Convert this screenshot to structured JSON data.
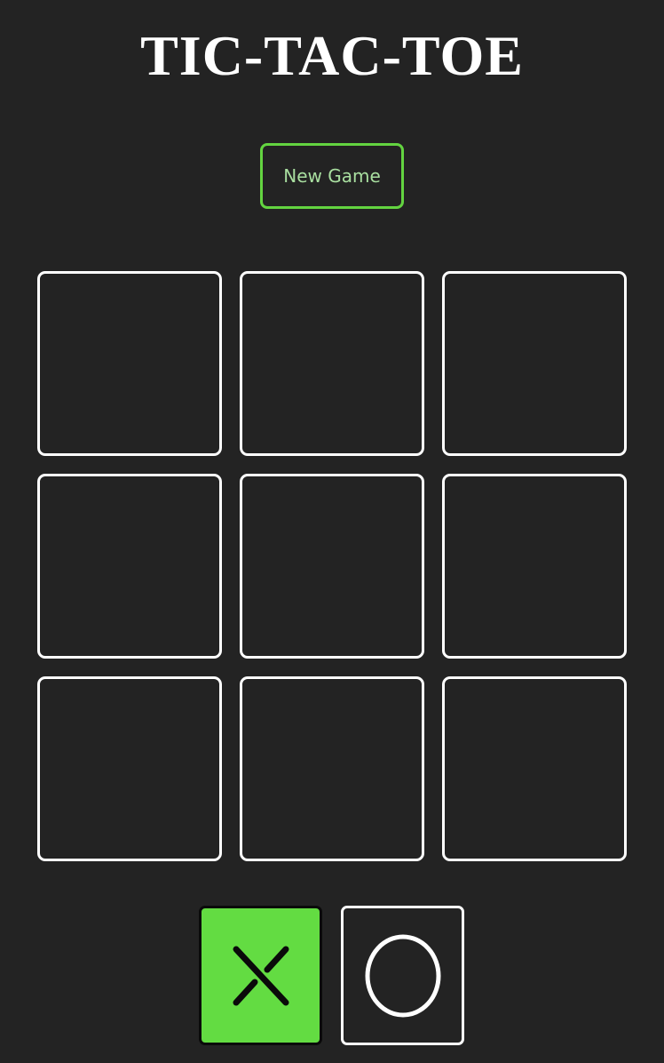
{
  "header": {
    "title": "TIC-TAC-TOE"
  },
  "controls": {
    "new_game_label": "New Game"
  },
  "board": {
    "cells": [
      "",
      "",
      "",
      "",
      "",
      "",
      "",
      "",
      ""
    ]
  },
  "player_select": {
    "options": [
      {
        "symbol": "X",
        "selected": true,
        "icon": "x-icon"
      },
      {
        "symbol": "O",
        "selected": false,
        "icon": "o-icon"
      }
    ]
  },
  "colors": {
    "background": "#232323",
    "accent": "#63dc42",
    "cell_border": "#ffffff",
    "button_text": "#a9dfa0"
  }
}
